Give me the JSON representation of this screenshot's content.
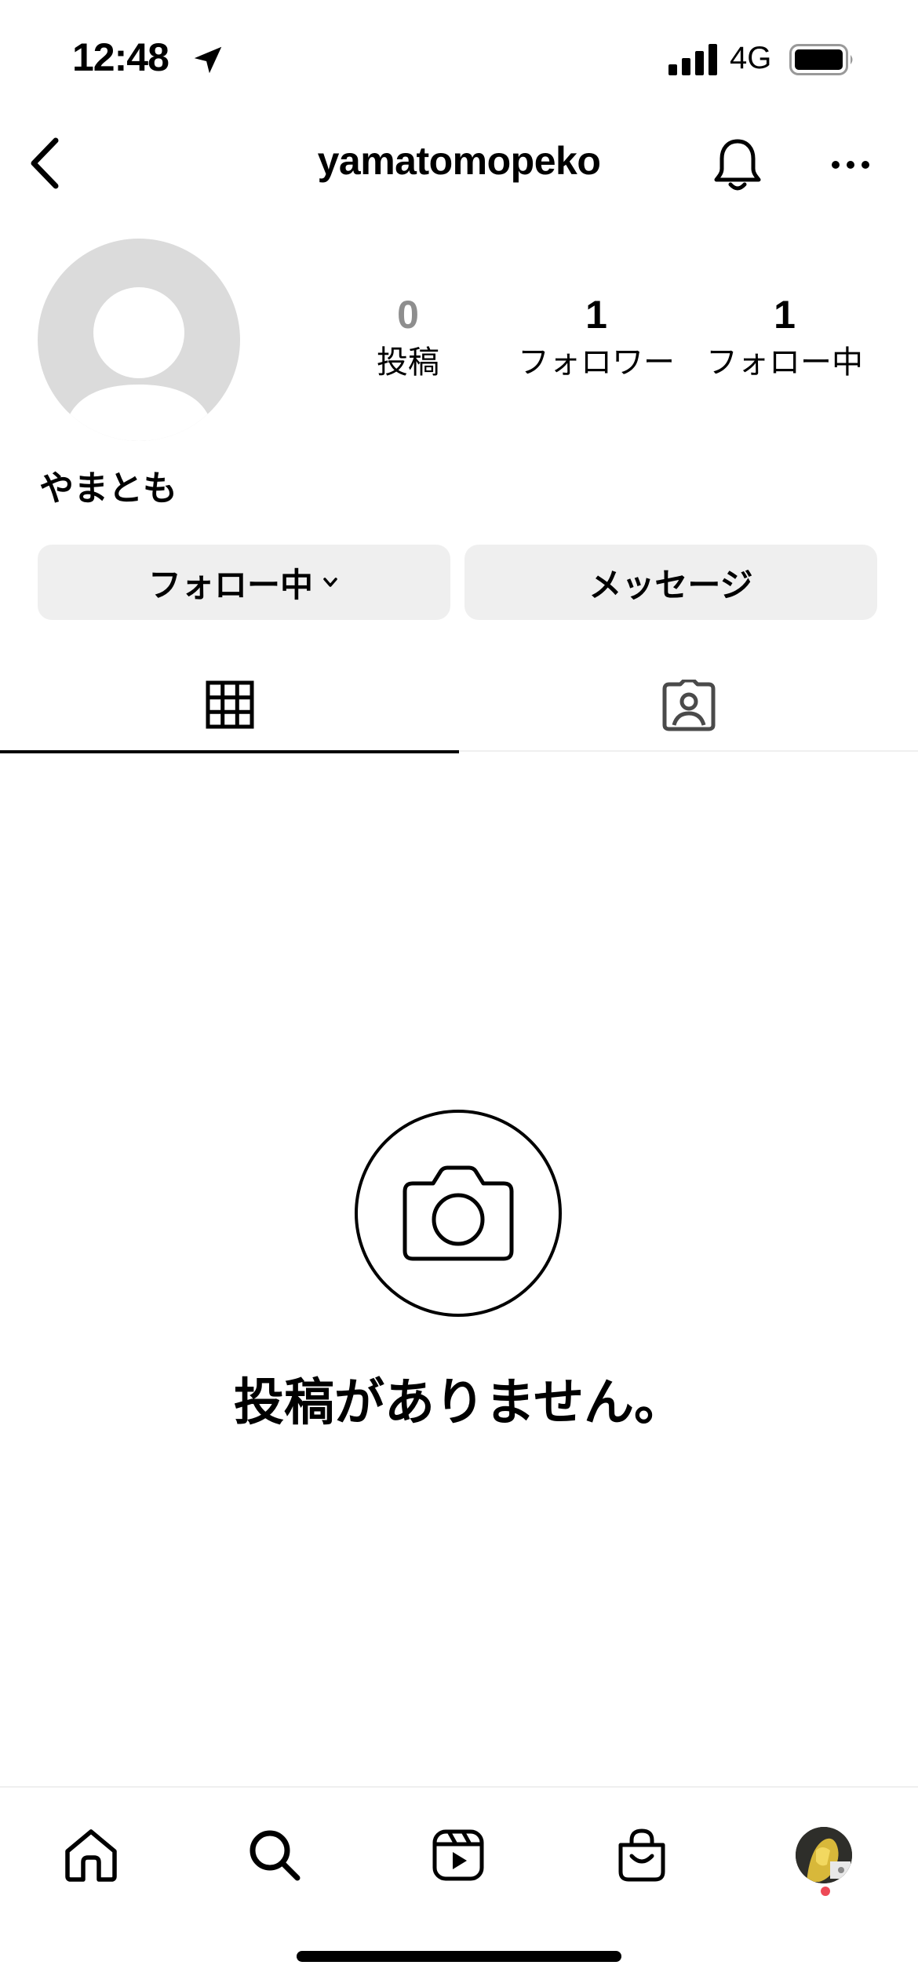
{
  "status_bar": {
    "time": "12:48",
    "network": "4G",
    "icons": [
      "location-arrow-icon",
      "signal-icon",
      "battery-icon"
    ]
  },
  "header": {
    "username": "yamatomopeko",
    "icons": [
      "chevron-left-icon",
      "bell-icon",
      "more-horizontal-icon"
    ]
  },
  "profile": {
    "display_name": "やまとも",
    "stats": [
      {
        "value": "0",
        "label": "投稿"
      },
      {
        "value": "1",
        "label": "フォロワー"
      },
      {
        "value": "1",
        "label": "フォロー中"
      }
    ]
  },
  "actions": {
    "follow_label": "フォロー中",
    "message_label": "メッセージ"
  },
  "tabs": [
    {
      "icon": "grid-icon",
      "active": true
    },
    {
      "icon": "tagged-person-icon",
      "active": false
    }
  ],
  "empty_state": {
    "icon": "camera-icon",
    "text": "投稿がありません。"
  },
  "bottom_nav": {
    "items": [
      "home-icon",
      "search-icon",
      "reels-icon",
      "shop-icon",
      "profile-avatar"
    ],
    "notification_color": "#ed4956"
  },
  "colors": {
    "button_bg": "#efefef",
    "avatar_bg": "#dbdbdb",
    "post_count_color": "#8e8e8e"
  }
}
